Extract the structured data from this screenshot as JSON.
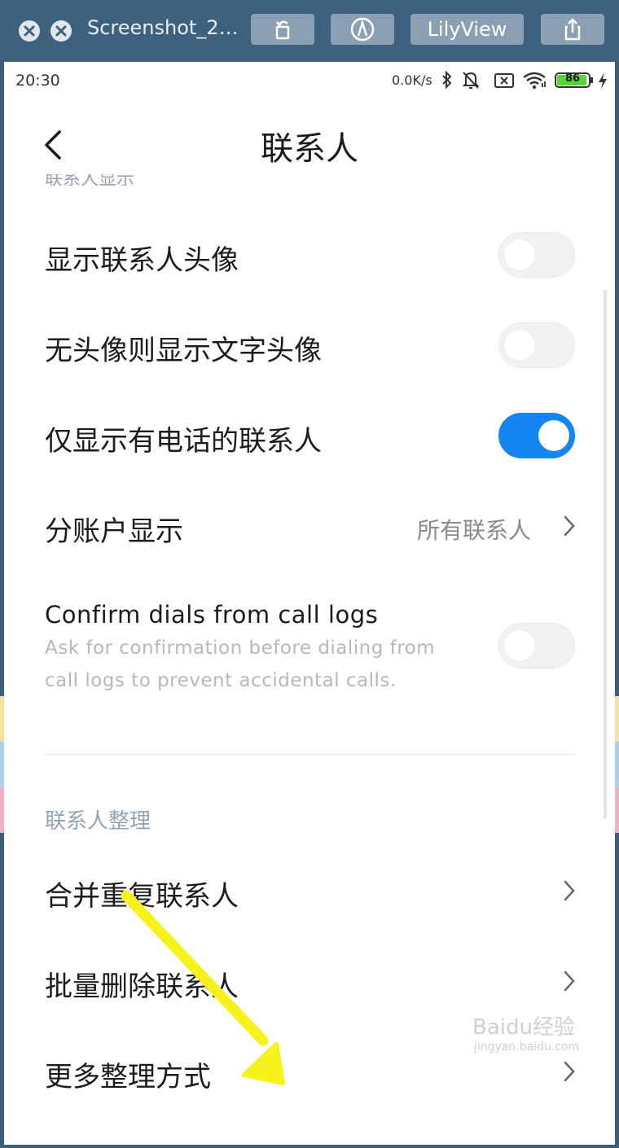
{
  "viewer": {
    "title": "Screenshot_2…",
    "lilyview_label": "LilyView",
    "close_icon": "close-icon",
    "minimize_icon": "minimize-icon",
    "rotate_icon": "rotate-icon",
    "annotate_icon": "markup-icon",
    "share_icon": "share-icon"
  },
  "status_bar": {
    "time": "20:30",
    "network_speed": "0.0K/s",
    "battery_level": "86",
    "icons": [
      "bluetooth-icon",
      "mute-icon",
      "sim-off-icon",
      "wifi-icon",
      "battery-icon",
      "charging-icon"
    ]
  },
  "nav": {
    "back_icon": "back-arrow-icon",
    "title": "联系人"
  },
  "settings": {
    "rows": [
      {
        "label": "显示联系人头像",
        "toggle": false
      },
      {
        "label": "无头像则显示文字头像",
        "toggle": false
      },
      {
        "label": "仅显示有电话的联系人",
        "toggle": true
      },
      {
        "label": "分账户显示",
        "value": "所有联系人"
      }
    ],
    "confirm": {
      "title": "Confirm dials from call logs",
      "subtitle_line1": "Ask for confirmation before dialing from",
      "subtitle_line2": "call logs to prevent accidental calls.",
      "toggle": false
    },
    "section_title": "联系人整理",
    "organize_items": [
      {
        "label": "合并重复联系人"
      },
      {
        "label": "批量删除联系人"
      },
      {
        "label": "更多整理方式"
      }
    ]
  },
  "colors": {
    "accent": "#1486f2",
    "annotation_arrow": "#f6f21b",
    "section_text": "#93a3b5"
  },
  "watermark": {
    "brand": "Bai",
    "brand2": "du",
    "product": "经验",
    "url": "jingyan.baidu.com"
  }
}
